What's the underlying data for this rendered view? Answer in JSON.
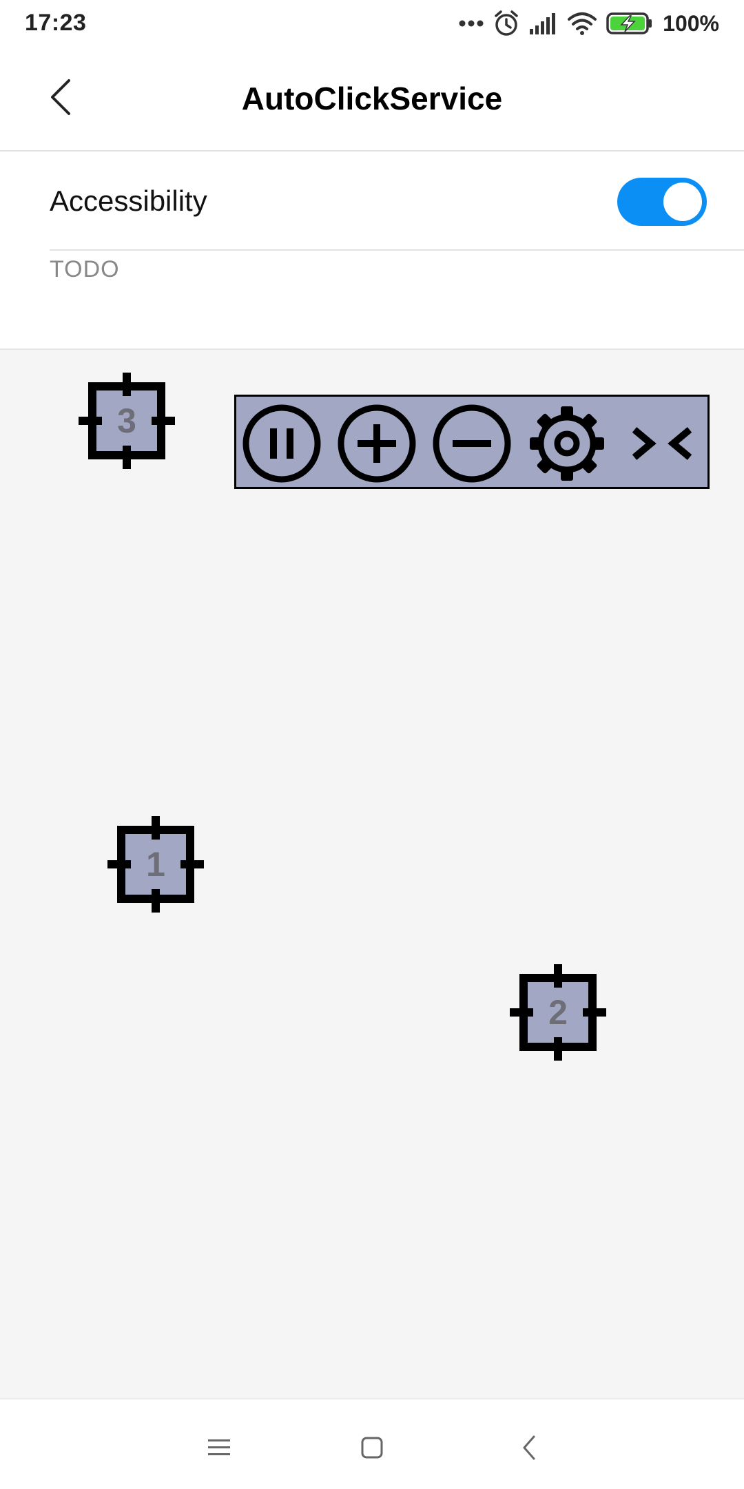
{
  "status_bar": {
    "time": "17:23",
    "battery": "100%",
    "icons": [
      "more-dots-icon",
      "alarm-icon",
      "signal-icon",
      "wifi-icon",
      "battery-charging-icon"
    ]
  },
  "app_bar": {
    "title": "AutoClickService",
    "back_icon": "chevron-left-icon"
  },
  "settings": {
    "accessibility_label": "Accessibility",
    "accessibility_enabled": true,
    "summary": "TODO"
  },
  "targets": [
    {
      "label": "3"
    },
    {
      "label": "1"
    },
    {
      "label": "2"
    }
  ],
  "control_bar": {
    "buttons": [
      "pause-icon",
      "add-icon",
      "remove-icon",
      "settings-gear-icon",
      "collapse-icon"
    ]
  },
  "nav_bar": {
    "buttons": [
      "menu-icon",
      "home-icon",
      "back-icon"
    ]
  },
  "colors": {
    "accent": "#0c8ff5",
    "overlay_fill": "#a2a7c4",
    "background": "#f5f5f5"
  }
}
